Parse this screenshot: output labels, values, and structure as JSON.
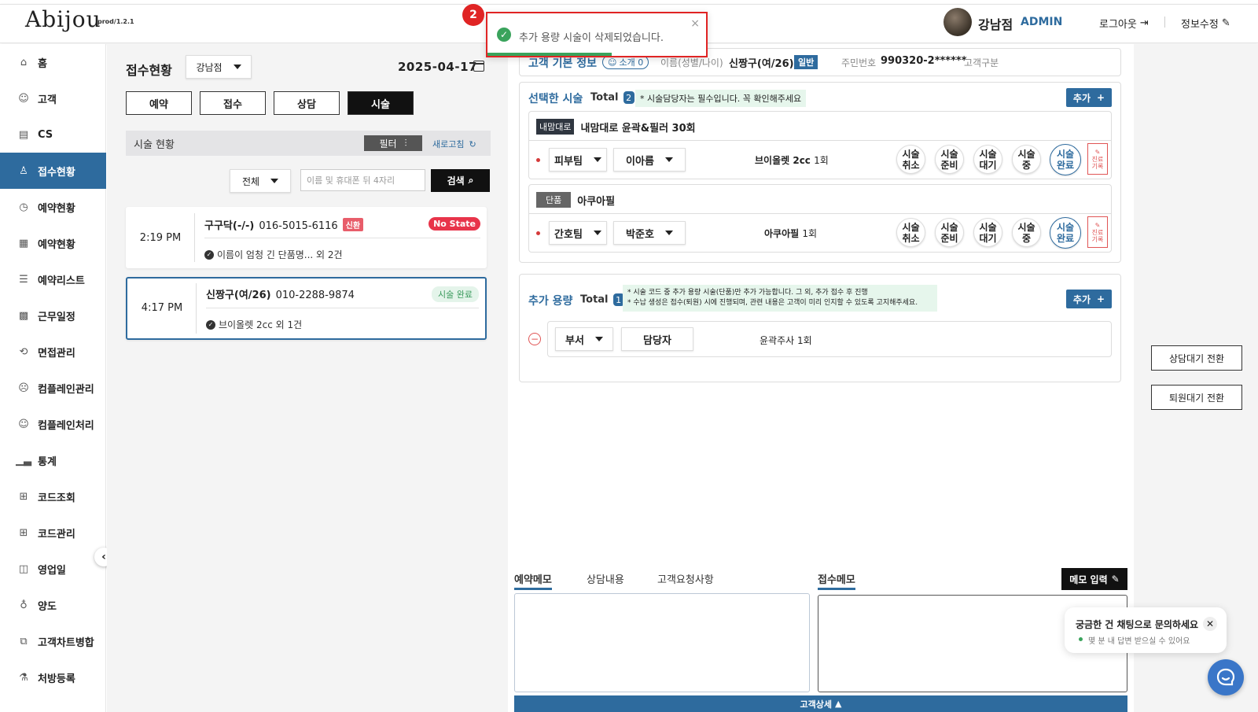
{
  "header": {
    "logo": "Abijou",
    "version": "prod/1.2.1",
    "user_name": "강남점",
    "user_role": "ADMIN",
    "logout_label": "로그아웃",
    "edit_info_label": "정보수정"
  },
  "toast": {
    "step": "2",
    "message": "추가 용량 시술이 삭제되었습니다.",
    "close": "×"
  },
  "sidebar": {
    "items": [
      {
        "label": "홈",
        "icon": "home-icon"
      },
      {
        "label": "고객",
        "icon": "people-icon"
      },
      {
        "label": "CS",
        "icon": "clipboard-user-icon"
      },
      {
        "label": "접수현황",
        "icon": "reception-icon"
      },
      {
        "label": "예약현황",
        "icon": "calendar-clock-icon"
      },
      {
        "label": "예약현황",
        "icon": "calendar-person-icon"
      },
      {
        "label": "예약리스트",
        "icon": "list-icon"
      },
      {
        "label": "근무일정",
        "icon": "calendar-grid-icon"
      },
      {
        "label": "면접관리",
        "icon": "interview-icon"
      },
      {
        "label": "컴플레인관리",
        "icon": "smile-icon"
      },
      {
        "label": "컴플레인처리",
        "icon": "smile-check-icon"
      },
      {
        "label": "통계",
        "icon": "chart-icon"
      },
      {
        "label": "코드조회",
        "icon": "hierarchy-icon"
      },
      {
        "label": "코드관리",
        "icon": "hierarchy-icon"
      },
      {
        "label": "영업일",
        "icon": "calendar-day-icon"
      },
      {
        "label": "양도",
        "icon": "transfer-icon"
      },
      {
        "label": "고객차트병합",
        "icon": "merge-icon"
      },
      {
        "label": "처방등록",
        "icon": "pill-icon"
      }
    ],
    "collapse": "‹"
  },
  "left": {
    "title": "접수현황",
    "branch": "강남점",
    "date": "2025-04-17",
    "tabs": [
      "예약",
      "접수",
      "상담",
      "시술"
    ],
    "status_title": "시술 현황",
    "filter_label": "필터",
    "refresh_label": "새로고침",
    "all_option": "전체",
    "search_placeholder": "이름 및 휴대폰 뒤 4자리",
    "search_label": "검색",
    "cards": [
      {
        "time": "2:19 PM",
        "name": "구구닥(-/-)",
        "phone": "016-5015-6116",
        "new_badge": "신환",
        "state": "No State",
        "summary": "이름이 엄청 긴 단품명... 외 2건"
      },
      {
        "time": "4:17 PM",
        "name": "신짱구(여/26)",
        "phone": "010-2288-9874",
        "state": "시술 완료",
        "summary": "브이올렛 2cc 외 1건"
      }
    ]
  },
  "customer": {
    "section_title": "고객 기본 정보",
    "referral": "소개 0",
    "name_label": "이름(성별/나이)",
    "name_value": "신짱구(여/26)",
    "grade": "일반",
    "rrn_label": "주민번호",
    "rrn_value": "990320-2******",
    "type_label": "고객구분"
  },
  "selected": {
    "title": "선택한 시술",
    "total_label": "Total",
    "total": "2",
    "note": "* 시술담당자는 필수입니다. 꼭 확인해주세요",
    "add_label": "추가",
    "procedures": [
      {
        "tag": "내맘대로",
        "name": "내맘대로 윤곽&필러 30회",
        "team": "피부팀",
        "staff": "이아름",
        "item": "브이올렛 2cc",
        "count": "1회"
      },
      {
        "tag": "단품",
        "name": "아쿠아필",
        "team": "간호팀",
        "staff": "박준호",
        "item": "아쿠아필",
        "count": "1회"
      }
    ],
    "actions": [
      "시술\n취소",
      "시술\n준비",
      "시술\n대기",
      "시술\n중",
      "시술\n완료"
    ],
    "record": [
      "진료",
      "기록"
    ]
  },
  "extra": {
    "title": "추가 용량",
    "total_label": "Total",
    "total": "1",
    "note_1": "* 시술 코드 중 추가 용량 시술(단품)만 추가 가능합니다. 그 외, 추가 접수 후 진행",
    "note_2": "* 수납 생성은 접수(퇴원) 시에 진행되며, 관련 내용은 고객이 미리 인지할 수 있도록 고지해주세요.",
    "add_label": "추가",
    "dept": "부서",
    "staff": "담당자",
    "item": "윤곽주사",
    "count": "1회"
  },
  "memo": {
    "tabs": [
      "예약메모",
      "상담내용",
      "고객요청사항"
    ],
    "reception_title": "접수메모",
    "input_label": "메모 입력",
    "detail_label": "고객상세"
  },
  "right": {
    "consult_wait": "상담대기 전환",
    "discharge_wait": "퇴원대기 전환"
  },
  "chat": {
    "title": "궁금한 건 채팅으로 문의하세요",
    "sub": "몇 분 내 답변 받으실 수 있어요",
    "close": "✕"
  }
}
